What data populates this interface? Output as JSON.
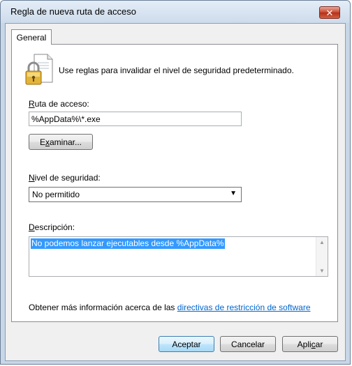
{
  "window": {
    "title": "Regla de nueva ruta de acceso",
    "close_glyph": "✕"
  },
  "tabs": [
    {
      "label": "General",
      "selected": true
    }
  ],
  "intro": {
    "icon": "lock-document-icon",
    "text": "Use reglas para invalidar el nivel de seguridad predeterminado."
  },
  "path": {
    "label_accel": "R",
    "label_rest": "uta de acceso:",
    "value": "%AppData%\\*.exe"
  },
  "browse_button": {
    "accel": "x",
    "before": "E",
    "after": "aminar..."
  },
  "security_level": {
    "label_accel": "N",
    "label_rest": "ivel de seguridad:",
    "value": "No permitido",
    "arrow": "▼"
  },
  "description": {
    "label_accel": "D",
    "label_rest": "escripción:",
    "value": "No podemos lanzar ejecutables desde %AppData%"
  },
  "more_info": {
    "text": "Obtener más información acerca de las ",
    "link": "directivas de restricción de software"
  },
  "buttons": {
    "accept": "Aceptar",
    "cancel": "Cancelar",
    "apply_before": "Apli",
    "apply_accel": "c",
    "apply_after": "ar"
  },
  "colors": {
    "title_bar": "#cddbeb",
    "close_button": "#c8442c",
    "selection": "#3399ff",
    "link": "#0066cc"
  }
}
